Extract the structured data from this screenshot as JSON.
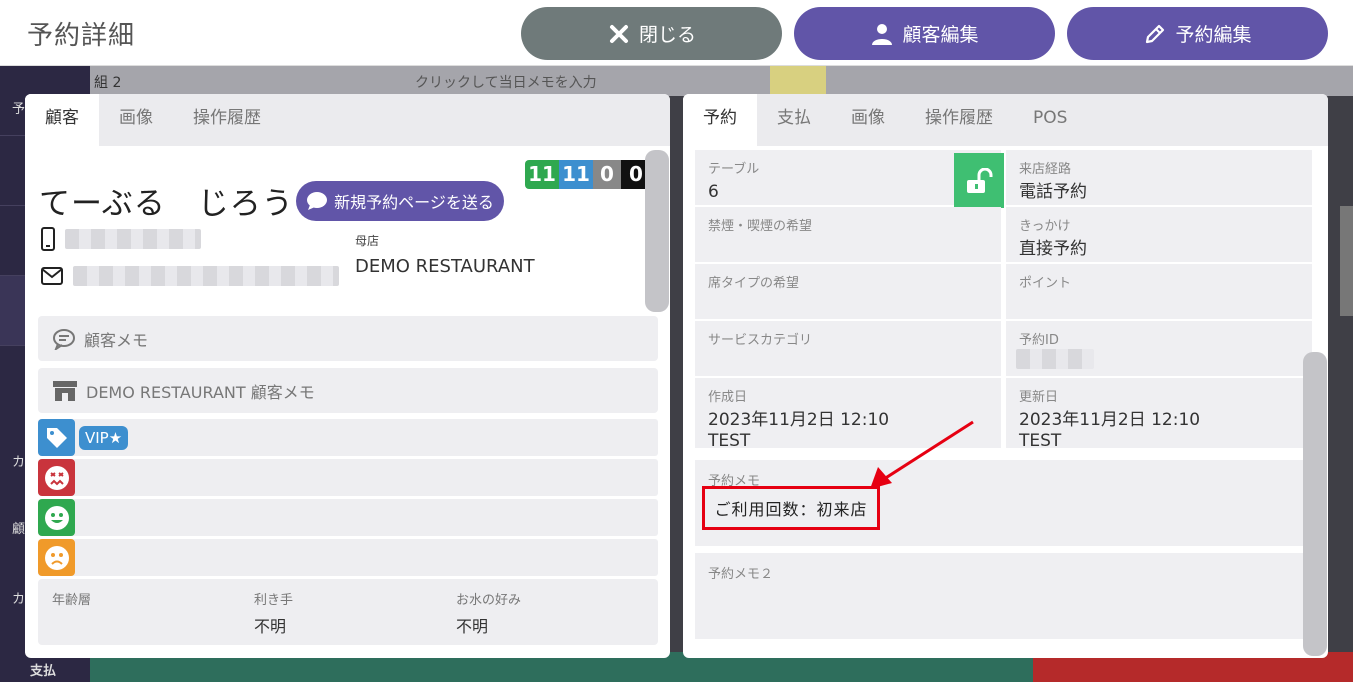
{
  "header": {
    "title": "予約詳細",
    "close_label": "閉じる",
    "edit_customer_label": "顧客編集",
    "edit_reservation_label": "予約編集"
  },
  "background": {
    "toolbar_counts": "組 2",
    "memo_placeholder": "クリックして当日メモを入力",
    "sidebar_labels": [
      "予",
      "カ",
      "顧",
      "カ",
      "支払"
    ]
  },
  "left_panel": {
    "tabs": [
      "顧客",
      "画像",
      "操作履歴"
    ],
    "active_tab": "顧客",
    "visit_counts": [
      "11",
      "11",
      "0",
      "0"
    ],
    "customer_name": "てーぶる　じろう",
    "send_button_label": "新規予約ページを送る",
    "home_store_label": "母店",
    "home_store_value": "DEMO RESTAURANT",
    "customer_memo_label": "顧客メモ",
    "store_memo_label": "DEMO RESTAURANT 顧客メモ",
    "tag_vip": "VIP★",
    "attributes": [
      {
        "label": "年齢層",
        "value": ""
      },
      {
        "label": "利き手",
        "value": "不明"
      },
      {
        "label": "お水の好み",
        "value": "不明"
      }
    ]
  },
  "right_panel": {
    "tabs": [
      "予約",
      "支払",
      "画像",
      "操作履歴",
      "POS"
    ],
    "active_tab": "予約",
    "fields": {
      "table_label": "テーブル",
      "table_value": "6",
      "route_label": "来店経路",
      "route_value": "電話予約",
      "smoking_label": "禁煙・喫煙の希望",
      "smoking_value": "",
      "trigger_label": "きっかけ",
      "trigger_value": "直接予約",
      "seat_label": "席タイプの希望",
      "seat_value": "",
      "point_label": "ポイント",
      "point_value": "",
      "service_label": "サービスカテゴリ",
      "service_value": "",
      "id_label": "予約ID",
      "created_label": "作成日",
      "created_date": "2023年11月2日 12:10",
      "created_by": "TEST",
      "updated_label": "更新日",
      "updated_date": "2023年11月2日 12:10",
      "updated_by": "TEST"
    },
    "memo_label": "予約メモ",
    "memo_value": "ご利用回数：初来店",
    "memo2_label": "予約メモ２"
  },
  "colors": {
    "accent_purple": "#6155a8",
    "close_gray": "#6f7a7a",
    "lock_green": "#3fbf72",
    "highlight_red": "#e60012"
  }
}
